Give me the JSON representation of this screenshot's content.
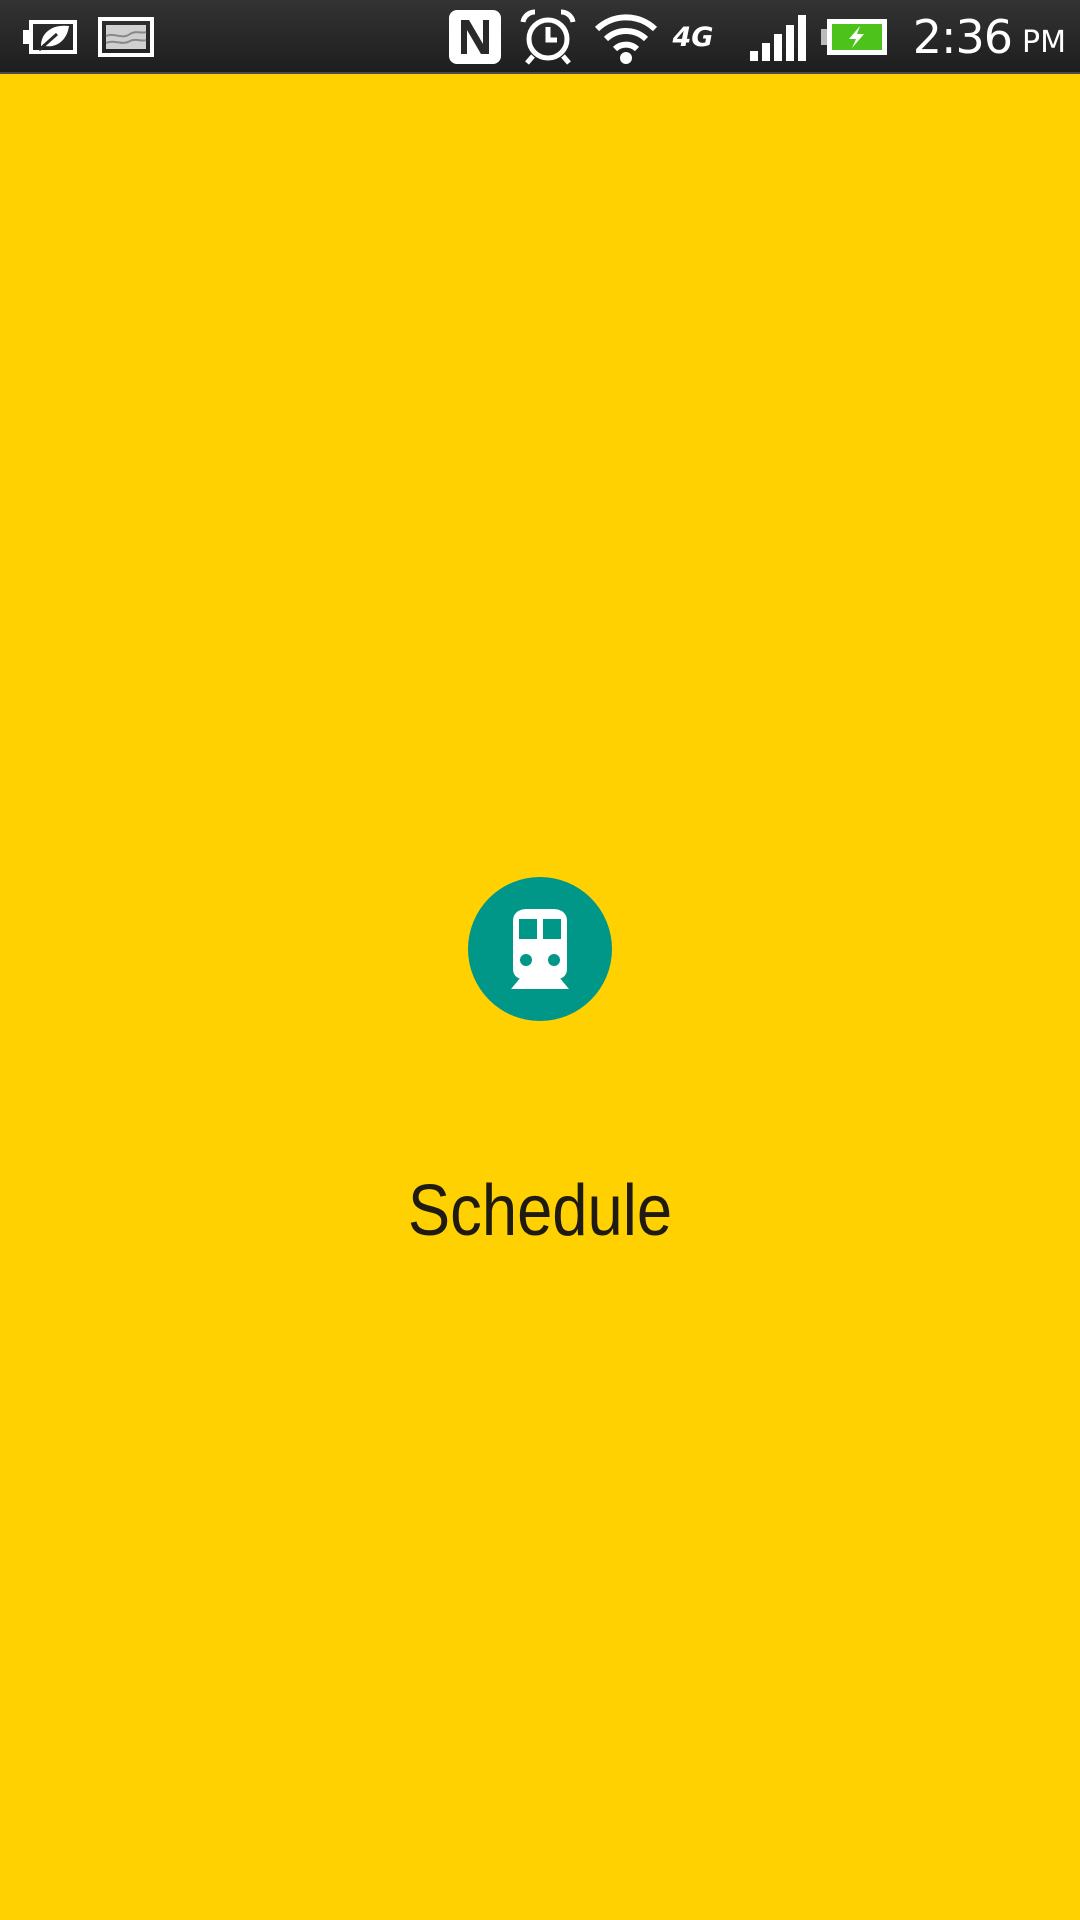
{
  "status_bar": {
    "time": "2:36",
    "ampm": "PM",
    "network_type": "4G",
    "battery_charging": true,
    "battery_color": "#4CC21A",
    "icons": [
      "power-saver-icon",
      "gallery-notification-icon",
      "nfc-icon",
      "alarm-icon",
      "wifi-icon",
      "network-4g-icon",
      "signal-icon",
      "battery-charging-icon"
    ]
  },
  "splash": {
    "icon": "train-icon",
    "icon_bg_color": "#009688",
    "background_color": "#FFD100",
    "title": "Schedule"
  }
}
